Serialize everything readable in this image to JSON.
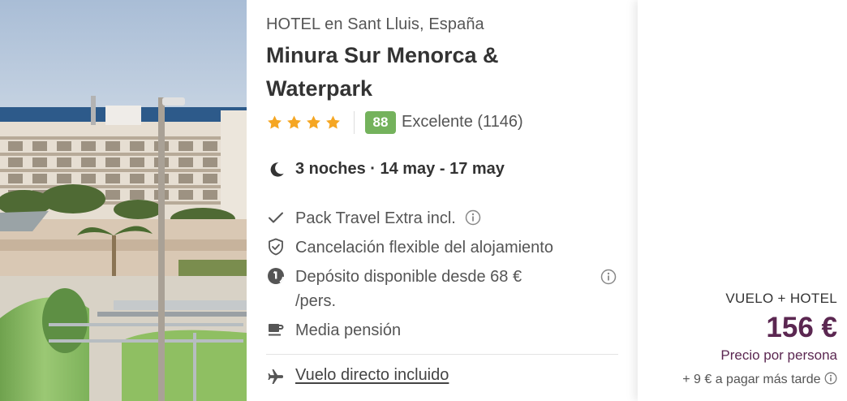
{
  "hotel": {
    "location": "HOTEL en Sant Lluis, España",
    "name": "Minura Sur Menorca & Waterpark",
    "stars": 4,
    "score": "88",
    "score_text": "Excelente (1146)",
    "dates": "3 noches · 14 may - 17 may"
  },
  "features": [
    {
      "icon": "checkmark-icon",
      "text": "Pack Travel Extra incl."
    },
    {
      "icon": "shield-check-icon",
      "text": "Cancelación flexible del alojamiento"
    },
    {
      "icon": "deposit-icon",
      "text": "Depósito disponible desde 68 €",
      "text2": "/pers."
    },
    {
      "icon": "coffee-cup-icon",
      "text": "Media pensión"
    }
  ],
  "flight": {
    "icon": "airplane-icon",
    "label": "Vuelo directo incluido"
  },
  "price": {
    "package_label": "VUELO + HOTEL",
    "amount": "156 €",
    "per_person": "Precio por persona",
    "pay_later": "+ 9 € a pagar más tarde"
  },
  "colors": {
    "score_badge": "#74b25c",
    "star": "#f5a623",
    "price": "#5b2751"
  }
}
